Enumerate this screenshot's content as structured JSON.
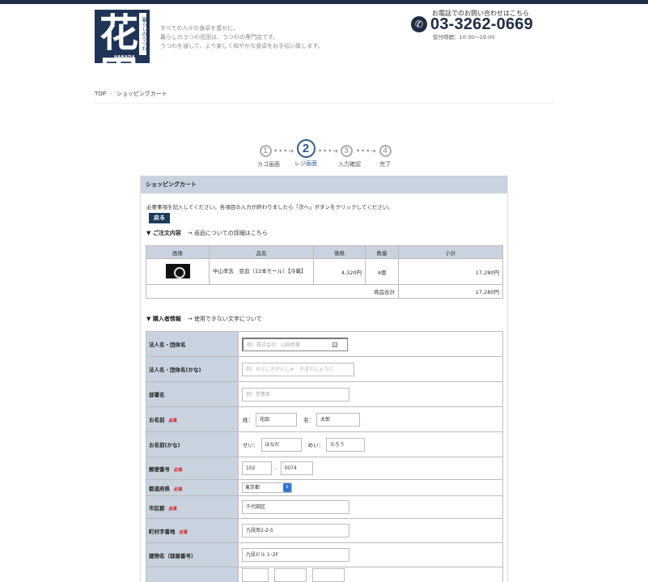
{
  "header": {
    "logo_kanji": "花\n田",
    "logo_vertical": "暮らしのうつわ",
    "logo_en": "HANADA",
    "tagline": [
      "すべての人々の食卓を豊かに。",
      "暮らしのうつわ花田は、うつわの専門店です。",
      "うつわを通して、より楽しく和やかな食卓をお手伝い致します。"
    ],
    "tel_heading": "お電話でのお問い合わせはこちら",
    "tel_icon": "phone-icon",
    "tel_number": "03-3262-0669",
    "hours": "受付時間：10:30〜19:00"
  },
  "breadcrumb": {
    "top": "TOP",
    "sep": "›",
    "current": "ショッピングカート"
  },
  "steps": [
    {
      "num": "1",
      "label": "カゴ画面"
    },
    {
      "num": "2",
      "label": "レジ画面"
    },
    {
      "num": "3",
      "label": "入力確認"
    },
    {
      "num": "4",
      "label": "完了"
    }
  ],
  "steps_dots": "•••➜",
  "panel": {
    "title": "ショッピングカート",
    "notice": "必要事項を記入してください。各項目の入力が終わりましたら「次へ」ボタンをクリックしてください。",
    "back_button": "戻る",
    "order_title": "▼ ご注文内容",
    "order_link": "→ 返品についての詳細はこちら",
    "buyer_title": "▼ 購入者情報",
    "buyer_link": "→ 使用できない文字について"
  },
  "order_table": {
    "headers": [
      "画像",
      "品名",
      "価格",
      "数量",
      "小計"
    ],
    "row": {
      "name": "中山孝志　豆皿（12本モール）【冷蔵】",
      "price": "4,320円",
      "qty": "4個",
      "subtotal": "17,280円"
    },
    "total_label": "商品合計",
    "total_value": "17,280円"
  },
  "form": {
    "required": "必須",
    "corp_name": {
      "label": "法人名・団体名",
      "placeholder": "例）株式会社　山田商事"
    },
    "corp_kana": {
      "label": "法人名・団体名(かな)",
      "placeholder": "例）かぶしきがいしゃ　やまだしょうじ"
    },
    "dept": {
      "label": "部署名",
      "placeholder": "例）営業部"
    },
    "name": {
      "label": "お名前",
      "sei_label": "姓：",
      "sei": "花田",
      "mei_label": "名：",
      "mei": "太郎"
    },
    "name_kana": {
      "label": "お名前(かな)",
      "sei_label": "せい：",
      "sei": "はなだ",
      "mei_label": "めい：",
      "mei": "たろう"
    },
    "zip": {
      "label": "郵便番号",
      "first": "102",
      "dash": "-",
      "second": "0074"
    },
    "pref": {
      "label": "都道府県",
      "value": "東京都"
    },
    "city": {
      "label": "市区郡",
      "value": "千代田区"
    },
    "town": {
      "label": "町村字番地",
      "value": "九段南2-2-5"
    },
    "building": {
      "label": "建物名（部屋番号）",
      "value": "九段ビル 1･2F"
    }
  }
}
